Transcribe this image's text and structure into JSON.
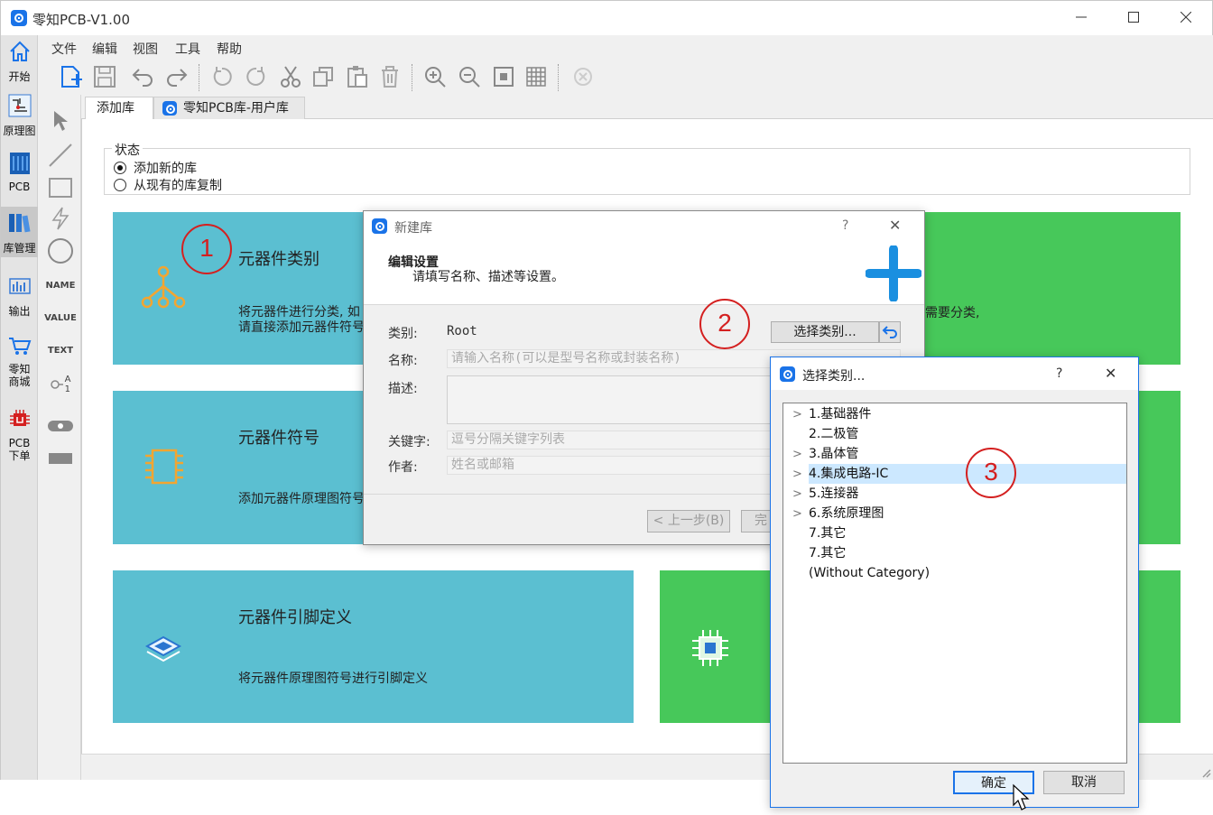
{
  "window": {
    "title": "零知PCB-V1.00"
  },
  "sidebar": {
    "items": [
      {
        "label": "开始",
        "icon": "home-icon"
      },
      {
        "label": "原理图",
        "icon": "schematic-icon"
      },
      {
        "label": "PCB",
        "icon": "pcb-icon"
      },
      {
        "label": "库管理",
        "icon": "library-icon"
      },
      {
        "label": "输出",
        "icon": "output-icon"
      },
      {
        "label": "零知",
        "label2": "商城",
        "icon": "cart-icon"
      },
      {
        "label": "PCB",
        "label2": "下单",
        "icon": "pcb-order-icon"
      }
    ]
  },
  "menu": {
    "items": [
      "文件",
      "编辑",
      "视图",
      "工具",
      "帮助"
    ]
  },
  "drawbar": {
    "name_label": "NAME",
    "value_label": "VALUE",
    "text_label": "TEXT",
    "pin_a": "A",
    "pin_1": "1"
  },
  "tabs": [
    {
      "label": "添加库"
    },
    {
      "label": "零知PCB库-用户库"
    }
  ],
  "status_group": {
    "title": "状态",
    "options": [
      {
        "label": "添加新的库",
        "checked": true
      },
      {
        "label": "从现有的库复制",
        "checked": false
      }
    ]
  },
  "cards": [
    {
      "title": "元器件类别",
      "desc1": "将元器件进行分类, 如",
      "desc2": "请直接添加元器件符号"
    },
    {
      "title": "元器件符号",
      "desc1": "添加元器件原理图符号"
    },
    {
      "title": "元器件引脚定义",
      "desc1": "将元器件原理图符号进行引脚定义"
    }
  ],
  "green_card_text": "需要分类,",
  "colors": {
    "teal": "#5bbfd1",
    "green": "#47c85a",
    "accent": "#1a73e8",
    "callout": "#d42020",
    "selection": "#cce8ff"
  },
  "callouts": [
    "1",
    "2",
    "3"
  ],
  "new_lib_dialog": {
    "title": "新建库",
    "help": "?",
    "close": "✕",
    "heading": "编辑设置",
    "subheading": "请填写名称、描述等设置。",
    "category_label": "类别:",
    "category_value": "Root",
    "select_button": "选择类别...",
    "name_label": "名称:",
    "name_placeholder": "请输入名称(可以是型号名称或封装名称)",
    "desc_label": "描述:",
    "keyword_label": "关键字:",
    "keyword_placeholder": "逗号分隔关键字列表",
    "author_label": "作者:",
    "author_placeholder": "姓名或邮箱",
    "prev_button": "< 上一步(B)",
    "finish_button": "完"
  },
  "category_dialog": {
    "title": "选择类别...",
    "help": "?",
    "close": "✕",
    "items": [
      {
        "label": "1.基础器件",
        "expandable": true
      },
      {
        "label": "2.二极管",
        "expandable": false
      },
      {
        "label": "3.晶体管",
        "expandable": true
      },
      {
        "label": "4.集成电路-IC",
        "expandable": true,
        "selected": true
      },
      {
        "label": "5.连接器",
        "expandable": true
      },
      {
        "label": "6.系统原理图",
        "expandable": true
      },
      {
        "label": "7.其它",
        "expandable": false
      },
      {
        "label": "7.其它",
        "expandable": false
      },
      {
        "label": "(Without Category)",
        "expandable": false
      }
    ],
    "ok_button": "确定",
    "cancel_button": "取消"
  }
}
